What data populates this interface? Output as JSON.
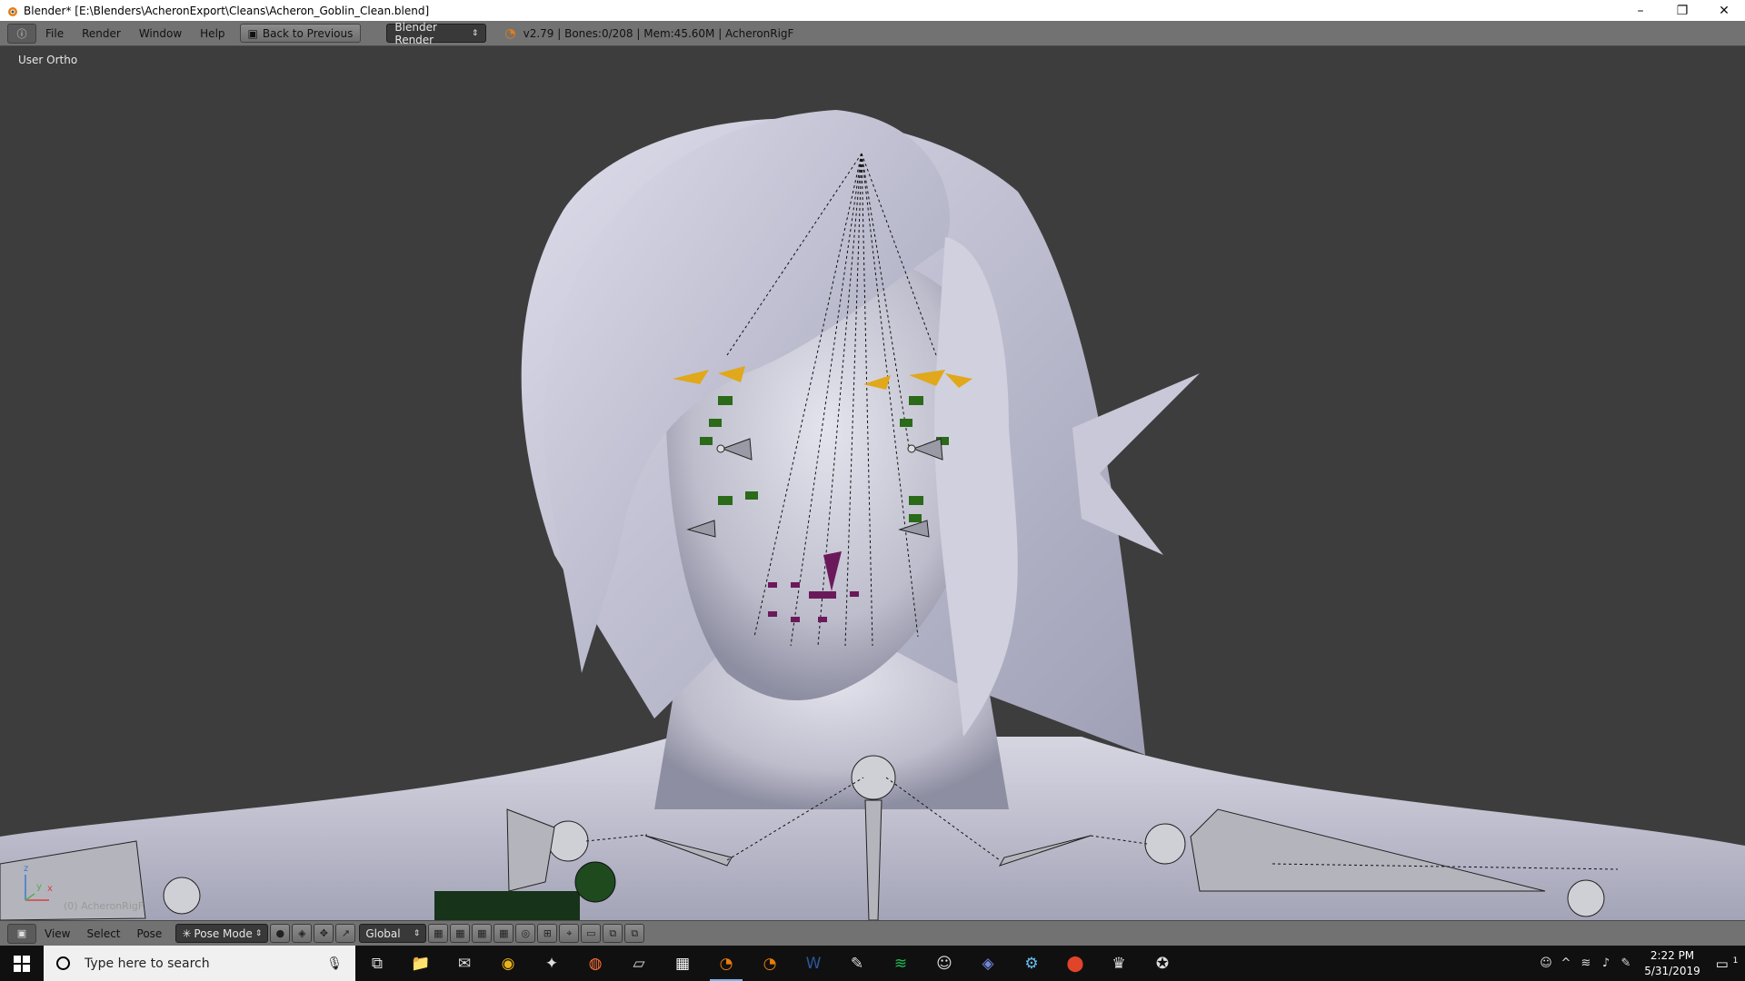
{
  "window": {
    "title": "Blender* [E:\\Blenders\\AcheronExport\\Cleans\\Acheron_Goblin_Clean.blend]",
    "controls": {
      "minimize": "–",
      "restore": "❐",
      "close": "✕"
    }
  },
  "info_header": {
    "editor_icon": "ⓘ",
    "menu": [
      "File",
      "Render",
      "Window",
      "Help"
    ],
    "back_button": "Back to Previous",
    "render_engine": "Blender Render",
    "stats": "v2.79 | Bones:0/208 | Mem:45.60M | AcheronRigF"
  },
  "viewport": {
    "view_label": "User Ortho",
    "object_label": "(0) AcheronRigF",
    "axis": {
      "x": "x",
      "y": "y",
      "z": "z"
    }
  },
  "view3d_header": {
    "menu": [
      "View",
      "Select",
      "Pose"
    ],
    "mode": "Pose Mode",
    "orientation": "Global"
  },
  "taskbar": {
    "search_placeholder": "Type here to search",
    "apps": [
      {
        "name": "task-view",
        "glyph": "⧉"
      },
      {
        "name": "file-explorer",
        "glyph": "📁"
      },
      {
        "name": "mail",
        "glyph": "✉"
      },
      {
        "name": "chrome",
        "glyph": "◉"
      },
      {
        "name": "app-generic",
        "glyph": "✦"
      },
      {
        "name": "firefox",
        "glyph": "◍"
      },
      {
        "name": "notepad",
        "glyph": "▱"
      },
      {
        "name": "calculator",
        "glyph": "▦"
      },
      {
        "name": "blender-a",
        "glyph": "◔"
      },
      {
        "name": "blender-b",
        "glyph": "◔"
      },
      {
        "name": "word",
        "glyph": "W"
      },
      {
        "name": "sketch",
        "glyph": "✎"
      },
      {
        "name": "spotify",
        "glyph": "≋"
      },
      {
        "name": "game-a",
        "glyph": "☺"
      },
      {
        "name": "discord",
        "glyph": "◈"
      },
      {
        "name": "steam",
        "glyph": "⚙"
      },
      {
        "name": "maps",
        "glyph": "⬤"
      },
      {
        "name": "game-b",
        "glyph": "♛"
      },
      {
        "name": "game-c",
        "glyph": "✪"
      }
    ],
    "clock_time": "2:22 PM",
    "clock_date": "5/31/2019",
    "notification_count": "1"
  }
}
